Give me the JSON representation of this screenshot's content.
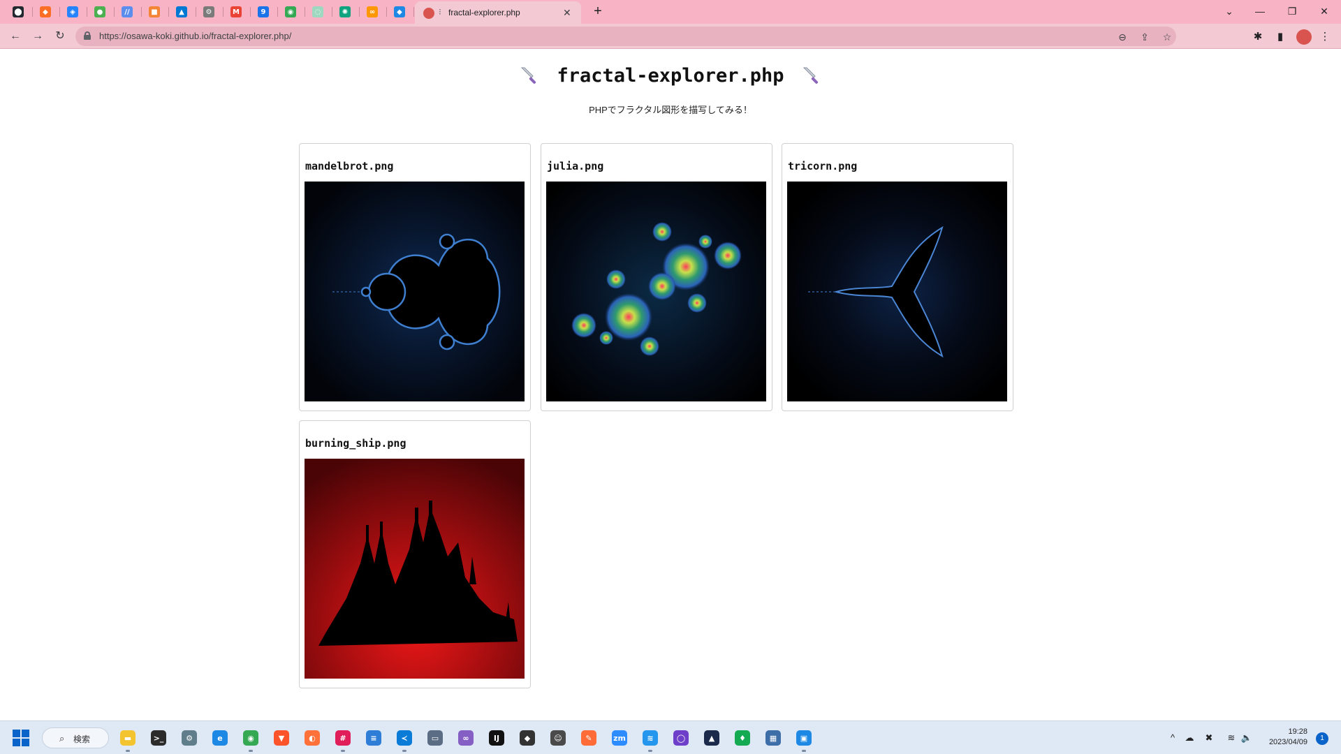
{
  "browser": {
    "pinned_tabs": [
      {
        "icon": "github-icon",
        "color": "#24292f",
        "glyph": "⬤"
      },
      {
        "icon": "gitlab-icon",
        "color": "#fc6d26",
        "glyph": "◆"
      },
      {
        "icon": "jira-icon",
        "color": "#2684ff",
        "glyph": "◈"
      },
      {
        "icon": "app-green-icon",
        "color": "#4caf50",
        "glyph": "●"
      },
      {
        "icon": "app-blue-lines-icon",
        "color": "#5b8def",
        "glyph": "//"
      },
      {
        "icon": "aws-icon",
        "color": "#f58536",
        "glyph": "■"
      },
      {
        "icon": "azure-icon",
        "color": "#0078d4",
        "glyph": "▲"
      },
      {
        "icon": "gear-app-icon",
        "color": "#7a7a7a",
        "glyph": "⚙"
      },
      {
        "icon": "gmail-icon",
        "color": "#ea4335",
        "glyph": "M"
      },
      {
        "icon": "calendar-icon",
        "color": "#1a73e8",
        "glyph": "9"
      },
      {
        "icon": "maps-icon",
        "color": "#34a853",
        "glyph": "◉"
      },
      {
        "icon": "app-mint-icon",
        "color": "#9fd8c0",
        "glyph": "◌"
      },
      {
        "icon": "chatgpt-icon",
        "color": "#10a37f",
        "glyph": "✺"
      },
      {
        "icon": "app-orange-icon",
        "color": "#ff9800",
        "glyph": "∞"
      },
      {
        "icon": "app-diamond-icon",
        "color": "#1e88e5",
        "glyph": "◆"
      }
    ],
    "active_tab": {
      "title": "fractal-explorer.php",
      "audio_indicator": "⁝",
      "close": "✕"
    },
    "new_tab": "+",
    "window": {
      "tab_search": "⌄",
      "minimize": "—",
      "restore": "❐",
      "close": "✕"
    },
    "nav": {
      "back": "←",
      "forward": "→",
      "reload": "↻"
    },
    "url": "https://osawa-koki.github.io/fractal-explorer.php/",
    "omnibox_icons": {
      "zoom": "⊖",
      "share": "⇪",
      "bookmark": "☆"
    },
    "toolbar_icons": {
      "extensions": "✱",
      "side_panel": "▮"
    }
  },
  "page": {
    "title": "fractal-explorer.php",
    "subtitle": "PHPでフラクタル図形を描写してみる！",
    "cards": [
      {
        "title": "mandelbrot.png",
        "image": "mandelbrot"
      },
      {
        "title": "julia.png",
        "image": "julia"
      },
      {
        "title": "tricorn.png",
        "image": "tricorn"
      },
      {
        "title": "burning_ship.png",
        "image": "burning_ship"
      }
    ]
  },
  "taskbar": {
    "search_label": "検索",
    "apps": [
      {
        "icon": "file-explorer-icon",
        "color": "#f4c430",
        "glyph": "▬",
        "running": true
      },
      {
        "icon": "terminal-icon",
        "color": "#2b2b2b",
        "glyph": ">_",
        "running": false
      },
      {
        "icon": "settings-icon",
        "color": "#607d8b",
        "glyph": "⚙",
        "running": false
      },
      {
        "icon": "edge-icon",
        "color": "#1e88e5",
        "glyph": "e",
        "running": false
      },
      {
        "icon": "chrome-icon",
        "color": "#34a853",
        "glyph": "◉",
        "running": true
      },
      {
        "icon": "brave-icon",
        "color": "#fb542b",
        "glyph": "▼",
        "running": false
      },
      {
        "icon": "firefox-icon",
        "color": "#ff7139",
        "glyph": "◐",
        "running": false
      },
      {
        "icon": "slack-icon",
        "color": "#e01e5a",
        "glyph": "#",
        "running": true
      },
      {
        "icon": "notes-icon",
        "color": "#2e7dd7",
        "glyph": "≡",
        "running": false
      },
      {
        "icon": "vscode-icon",
        "color": "#0a7bd6",
        "glyph": "≺",
        "running": true
      },
      {
        "icon": "remote-desktop-icon",
        "color": "#5a6d85",
        "glyph": "▭",
        "running": false
      },
      {
        "icon": "visual-studio-icon",
        "color": "#865fc5",
        "glyph": "∞",
        "running": false
      },
      {
        "icon": "jetbrains-icon",
        "color": "#111111",
        "glyph": "IJ",
        "running": false
      },
      {
        "icon": "inkscape-icon",
        "color": "#333333",
        "glyph": "◆",
        "running": false
      },
      {
        "icon": "app-face-icon",
        "color": "#4a4a4a",
        "glyph": "☺",
        "running": false
      },
      {
        "icon": "postman-icon",
        "color": "#ff6c37",
        "glyph": "✎",
        "running": false
      },
      {
        "icon": "zoom-icon",
        "color": "#2d8cff",
        "glyph": "zm",
        "running": false
      },
      {
        "icon": "docker-icon",
        "color": "#2496ed",
        "glyph": "≋",
        "running": true
      },
      {
        "icon": "github-desktop-icon",
        "color": "#6e40c9",
        "glyph": "◯",
        "running": false
      },
      {
        "icon": "app-helmet-icon",
        "color": "#1b2a4a",
        "glyph": "▲",
        "running": false
      },
      {
        "icon": "mongodb-icon",
        "color": "#13aa52",
        "glyph": "♦",
        "running": false
      },
      {
        "icon": "app-blocks-icon",
        "color": "#3d6ea8",
        "glyph": "▦",
        "running": false
      },
      {
        "icon": "app-monitor-icon",
        "color": "#1e88e5",
        "glyph": "▣",
        "running": true
      }
    ],
    "tray": {
      "chevron": "^",
      "cloud": "☁",
      "app": "✖",
      "wifi": "≋",
      "volume": "🔈"
    },
    "clock_time": "19:28",
    "clock_date": "2023/04/09",
    "notifications": "1"
  }
}
